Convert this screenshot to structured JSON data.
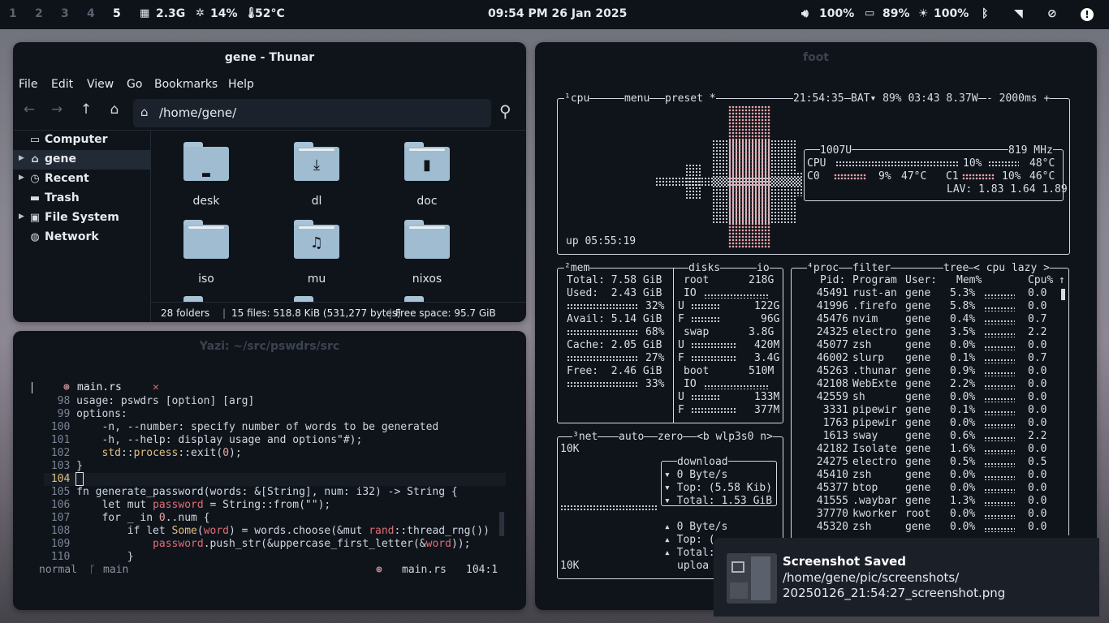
{
  "topbar": {
    "workspaces": [
      "1",
      "2",
      "3",
      "4",
      "5"
    ],
    "active_workspace": "5",
    "mem": "2.3G",
    "cpu": "14%",
    "temp": "52°C",
    "clock": "09:54 PM 26 Jan 2025",
    "volume": "100%",
    "battery": "89%",
    "brightness": "100%"
  },
  "thunar": {
    "title": "gene - Thunar",
    "menu": [
      "File",
      "Edit",
      "View",
      "Go",
      "Bookmarks",
      "Help"
    ],
    "path": "/home/gene/",
    "sidebar": [
      {
        "label": "Computer",
        "icon": "computer-icon",
        "arrow": false
      },
      {
        "label": "gene",
        "icon": "home-icon",
        "arrow": true
      },
      {
        "label": "Recent",
        "icon": "clock-icon",
        "arrow": true
      },
      {
        "label": "Trash",
        "icon": "trash-icon",
        "arrow": false
      },
      {
        "label": "File System",
        "icon": "drive-icon",
        "arrow": true
      },
      {
        "label": "Network",
        "icon": "globe-icon",
        "arrow": false
      }
    ],
    "files": [
      {
        "name": "desk",
        "icon": "desktop-folder-icon"
      },
      {
        "name": "dl",
        "icon": "download-folder-icon"
      },
      {
        "name": "doc",
        "icon": "document-folder-icon"
      },
      {
        "name": "iso",
        "icon": "folder-icon"
      },
      {
        "name": "mu",
        "icon": "music-folder-icon"
      },
      {
        "name": "nixos",
        "icon": "folder-icon"
      }
    ],
    "status": {
      "folders": "28 folders",
      "files": "15 files: 518.8 KiB (531,277 bytes)",
      "free": "Free space: 95.7 GiB"
    }
  },
  "yazi": {
    "title": "Yazi: ~/src/pswdrs/src",
    "tab": "main.rs",
    "lines": [
      [
        "98",
        "usage: pswdrs [option] [arg]"
      ],
      [
        "99",
        "options:"
      ],
      [
        "100",
        "    -n, --number: specify number of words to be generated"
      ],
      [
        "101",
        "    -h, --help: display usage and options\"#);"
      ],
      [
        "102",
        "    std::process::exit(0);"
      ],
      [
        "103",
        "}"
      ],
      [
        "104",
        ""
      ],
      [
        "105",
        "fn generate_password(words: &[String], num: i32) -> String {"
      ],
      [
        "106",
        "    let mut password = String::from(\"\");"
      ],
      [
        "107",
        "    for _ in 0..num {"
      ],
      [
        "108",
        "        if let Some(word) = words.choose(&mut rand::thread_rng())"
      ],
      [
        "109",
        "            password.push_str(&uppercase_first_letter(&word));"
      ],
      [
        "110",
        "        }"
      ]
    ],
    "mode": "normal",
    "branch": "main",
    "file": "main.rs",
    "position": "104:1"
  },
  "foot": {
    "title": "foot",
    "cpu": {
      "header": "¹cpu",
      "menu": "menu",
      "preset": "preset *",
      "clock": "21:54:35",
      "bat": "BAT▾ 89% 03:43 8.37W",
      "interval": "- 2000ms +",
      "model": "1007U",
      "freq": "819 MHz",
      "cpu_pct": "10%",
      "cpu_temp": "48°C",
      "c0_pct": "9%",
      "c0_temp": "47°C",
      "c1_pct": "10%",
      "c1_temp": "46°C",
      "lav": "LAV: 1.83 1.64 1.89",
      "uptime": "up 05:55:19"
    },
    "mem": {
      "header": "²mem",
      "total": "Total: 7.58 GiB",
      "used": "Used:  2.43 GiB",
      "used_pct": "32%",
      "avail": "Avail: 5.14 GiB",
      "avail_pct": "68%",
      "cache": "Cache: 2.05 GiB",
      "cache_pct": "27%",
      "free": "Free:  2.46 GiB",
      "free_pct": "33%"
    },
    "disks": {
      "header": "disks",
      "io": "io",
      "rows": [
        [
          "root",
          "218G"
        ],
        [
          "IO",
          ""
        ],
        [
          "U",
          "122G"
        ],
        [
          "F",
          "96G"
        ],
        [
          "swap",
          "3.8G"
        ],
        [
          "U",
          "420M"
        ],
        [
          "F",
          "3.4G"
        ],
        [
          "boot",
          "510M"
        ],
        [
          "IO",
          ""
        ],
        [
          "U",
          "133M"
        ],
        [
          "F",
          "377M"
        ]
      ]
    },
    "net": {
      "header": "³net",
      "auto": "auto",
      "zero": "zero",
      "iface": "<b wlp3s0 n>",
      "scale_top": "10K",
      "scale_bottom": "10K",
      "download": "download",
      "dl_rate": "▾ 0 Byte/s",
      "dl_top": "▾ Top: (5.58 Kib)",
      "dl_total": "▾ Total: 1.53 GiB",
      "ul_rate": "▴ 0 Byte/s",
      "ul_top": "▴ Top: (",
      "ul_total": "▴ Total:",
      "upload": "uploa"
    },
    "proc": {
      "header": "⁴proc",
      "filter": "filter",
      "tree": "tree",
      "sort": "< cpu lazy >",
      "columns": [
        "Pid:",
        "Program",
        "User:",
        "Mem%",
        "Cpu%"
      ],
      "rows": [
        [
          "45491",
          "rust-an",
          "gene",
          "5.3%",
          "0.0"
        ],
        [
          "41996",
          ".firefo",
          "gene",
          "5.8%",
          "0.0"
        ],
        [
          "45476",
          "nvim",
          "gene",
          "0.4%",
          "0.7"
        ],
        [
          "24325",
          "electro",
          "gene",
          "3.5%",
          "2.2"
        ],
        [
          "45077",
          "zsh",
          "gene",
          "0.0%",
          "0.0"
        ],
        [
          "46002",
          "slurp",
          "gene",
          "0.1%",
          "0.7"
        ],
        [
          "45263",
          ".thunar",
          "gene",
          "0.9%",
          "0.0"
        ],
        [
          "42108",
          "WebExte",
          "gene",
          "2.2%",
          "0.0"
        ],
        [
          "42559",
          "sh",
          "gene",
          "0.0%",
          "0.0"
        ],
        [
          "3331",
          "pipewir",
          "gene",
          "0.1%",
          "0.0"
        ],
        [
          "1763",
          "pipewir",
          "gene",
          "0.0%",
          "0.0"
        ],
        [
          "1613",
          "sway",
          "gene",
          "0.6%",
          "2.2"
        ],
        [
          "42182",
          "Isolate",
          "gene",
          "1.6%",
          "0.0"
        ],
        [
          "24275",
          "electro",
          "gene",
          "0.5%",
          "0.5"
        ],
        [
          "45410",
          "zsh",
          "gene",
          "0.0%",
          "0.0"
        ],
        [
          "45377",
          "btop",
          "gene",
          "0.0%",
          "0.0"
        ],
        [
          "41555",
          ".waybar",
          "gene",
          "1.3%",
          "0.0"
        ],
        [
          "37770",
          "kworker",
          "root",
          "0.0%",
          "0.0"
        ],
        [
          "45320",
          "zsh",
          "gene",
          "0.0%",
          "0.0"
        ]
      ]
    }
  },
  "notification": {
    "title": "Screenshot Saved",
    "line1": "/home/gene/pic/screenshots/",
    "line2": "20250126_21:54:27_screenshot.png"
  }
}
